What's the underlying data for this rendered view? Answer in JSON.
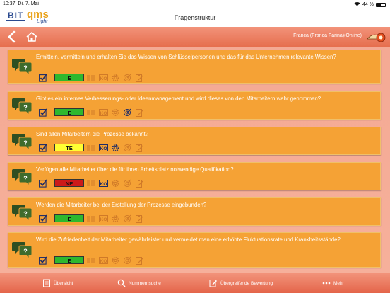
{
  "status": {
    "time": "10:37",
    "date": "Di. 7. Mai",
    "battery": "44 %"
  },
  "header": {
    "logo_bit": "BIT",
    "logo_qms": "qms",
    "logo_sub": "Light",
    "title": "Fragenstruktur"
  },
  "nav": {
    "user": "Franca (Franca Farina)(Online)"
  },
  "colors": {
    "accent": "#e66e4e",
    "card": "#f5a235",
    "rating_e": "#2eb82e",
    "rating_te": "#ffff33",
    "rating_ne": "#cc1a1a"
  },
  "questions": [
    {
      "text": "Ermitteln, vermitteln und erhalten Sie das Wissen von Schlüsselpersonen und das für das Unternehmen relevante Wissen?",
      "rating": "E",
      "rating_color": "#2eb82e",
      "lines": 2
    },
    {
      "text": "Gibt es ein internes Verbesserungs- oder Ideenmanagement und wird dieses von den Mitarbeitern wahr genommen?",
      "rating": "E",
      "rating_color": "#2eb82e",
      "lines": 1
    },
    {
      "text": "Sind allen Mitarbeitern die Prozesse bekannt?",
      "rating": "TE",
      "rating_color": "#ffff33",
      "lines": 1
    },
    {
      "text": "Verfügen alle Mitarbeiter über die für ihren Arbeitsplatz notwendige Qualifikation?",
      "rating": "NE",
      "rating_color": "#cc1a1a",
      "lines": 1
    },
    {
      "text": "Werden die Mitarbeiter bei der Erstellung der Prozesse eingebunden?",
      "rating": "E",
      "rating_color": "#2eb82e",
      "lines": 1
    },
    {
      "text": "Wird die Zufriedenheit der Mitarbeiter gewährleistet und vermeidet man eine erhöhte Fluktuationsrate und Krankheitsstände?",
      "rating": "E",
      "rating_color": "#2eb82e",
      "lines": 2
    }
  ],
  "tabs": [
    {
      "label": "Übersicht",
      "icon": "document-icon"
    },
    {
      "label": "Nummernsuche",
      "icon": "search-icon"
    },
    {
      "label": "Übergreifende Bewertung",
      "icon": "edit-icon"
    },
    {
      "label": "Mehr",
      "icon": "more-icon"
    }
  ]
}
